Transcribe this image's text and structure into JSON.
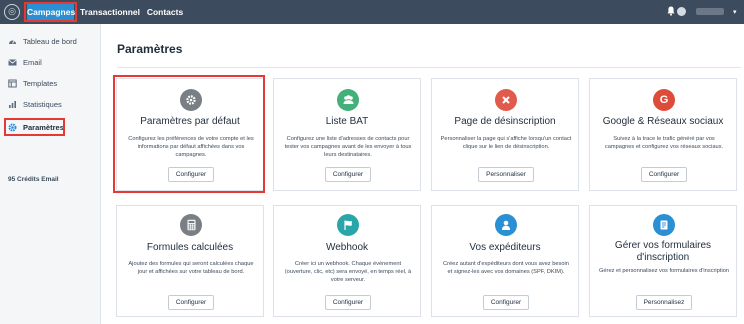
{
  "topbar": {
    "logo_icon": "brand-logo-icon",
    "nav": [
      {
        "label": "Campagnes",
        "active": true
      },
      {
        "label": "Transactionnel",
        "active": false
      },
      {
        "label": "Contacts",
        "active": false
      }
    ],
    "bell_icon": "bell-icon"
  },
  "sidebar": {
    "items": [
      {
        "label": "Tableau de bord",
        "icon": "dashboard-icon"
      },
      {
        "label": "Email",
        "icon": "email-icon"
      },
      {
        "label": "Templates",
        "icon": "template-icon"
      },
      {
        "label": "Statistiques",
        "icon": "statistics-icon"
      },
      {
        "label": "Paramètres",
        "icon": "gear-icon",
        "active": true
      }
    ],
    "credits": "95 Crédits Email"
  },
  "main": {
    "title": "Paramètres",
    "cards": [
      {
        "title": "Paramètres par défaut",
        "icon": "gear-icon",
        "icon_color": "#7a7f85",
        "description": "Configurez les préférences de votre compte et les informations par défaut affichées dans vos campagnes.",
        "button": "Configurer"
      },
      {
        "title": "Liste BAT",
        "icon": "group-icon",
        "icon_color": "#43b07a",
        "description": "Configurez une liste d'adresses de contacts pour tester vos campagnes avant de les envoyer à tous leurs destinataires.",
        "button": "Configurer"
      },
      {
        "title": "Page de désinscription",
        "icon": "unsubscribe-icon",
        "icon_color": "#e05b4b",
        "description": "Personnaliser la page qui s'affiche lorsqu'un contact clique sur le lien de désinscription.",
        "button": "Personnaliser"
      },
      {
        "title": "Google & Réseaux sociaux",
        "icon": "google-icon",
        "icon_color": "#dd4b39",
        "description": "Suivez à la trace le trafic généré par vos campagnes et configurez vos réseaux sociaux.",
        "button": "Configurer"
      },
      {
        "title": "Formules calculées",
        "icon": "calculator-icon",
        "icon_color": "#7a7f85",
        "description": "Ajoutez des formules qui seront calculées chaque jour et affichées sur votre tableau de bord.",
        "button": "Configurer"
      },
      {
        "title": "Webhook",
        "icon": "flag-icon",
        "icon_color": "#2aa6a8",
        "description": "Créer ici un webhook. Chaque événement (ouverture, clic, etc) sera envoyé, en temps réel, à votre serveur.",
        "button": "Configurer"
      },
      {
        "title": "Vos expéditeurs",
        "icon": "user-icon",
        "icon_color": "#2a8fd3",
        "description": "Créez autant d'expéditeurs dont vous avez besoin et signez-les avec vos domaines (SPF, DKIM).",
        "button": "Configurer"
      },
      {
        "title": "Gérer vos formulaires d'inscription",
        "icon": "form-icon",
        "icon_color": "#2a8fd3",
        "description": "Gérez et personnalisez vos formulaires d'inscription",
        "button": "Personnalisez"
      }
    ]
  }
}
